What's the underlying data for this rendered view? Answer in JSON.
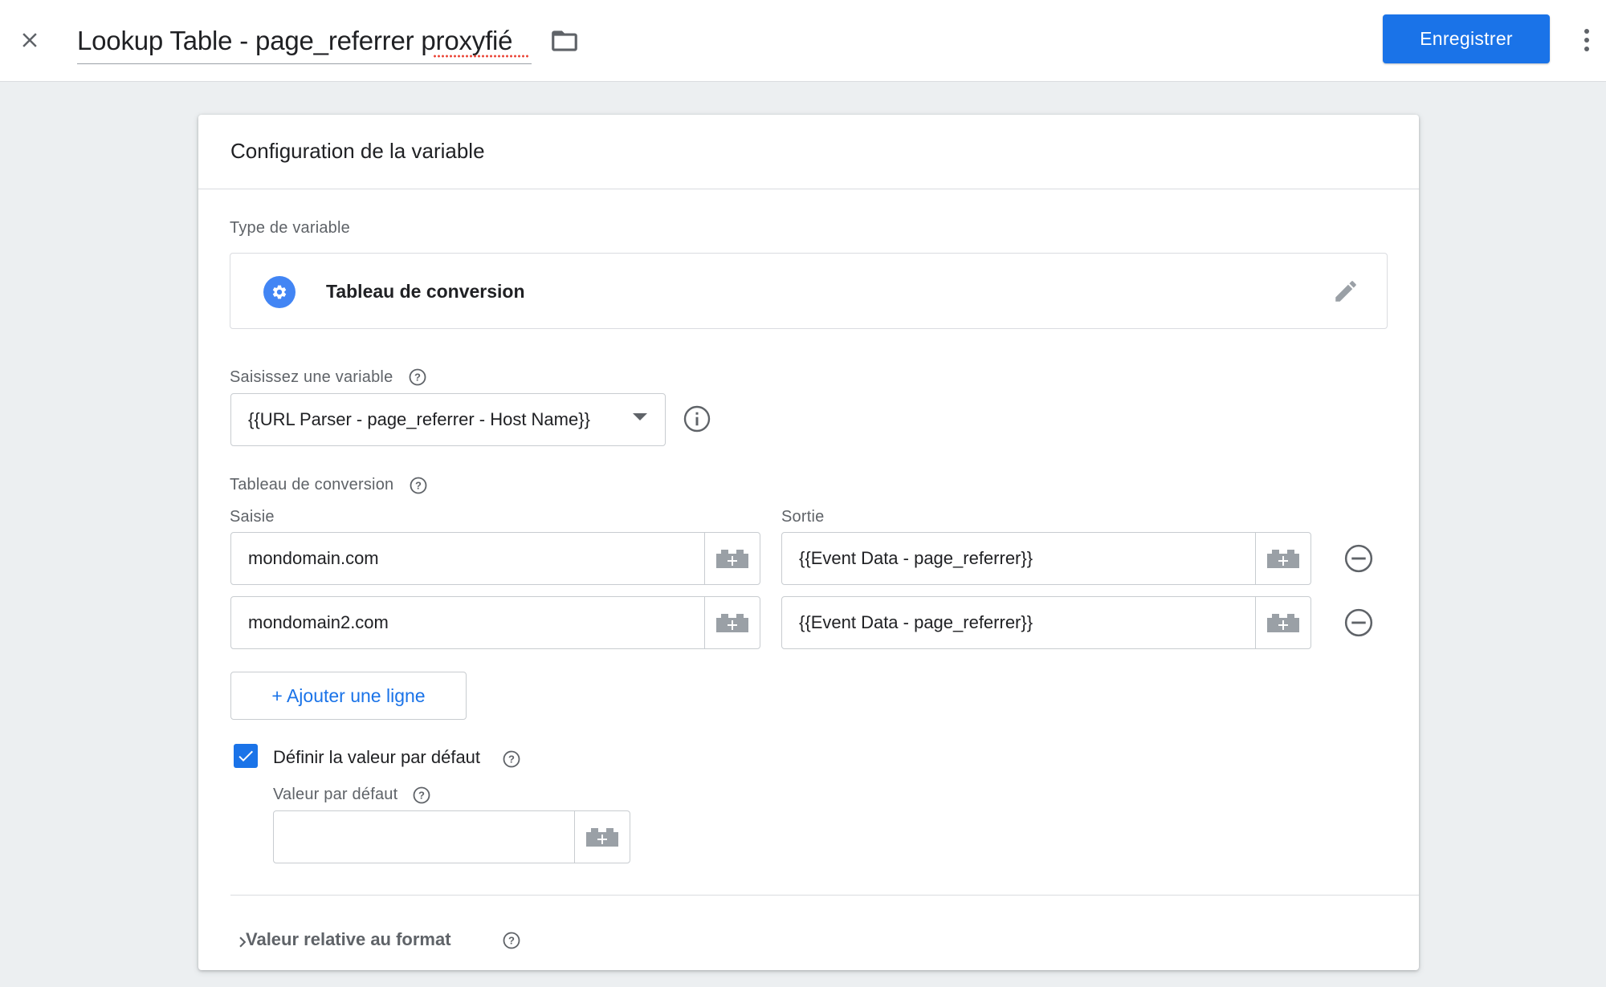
{
  "header": {
    "close_icon": "close-icon",
    "title": "Lookup Table - page_referrer proxyfié",
    "folder_icon": "folder-icon",
    "save_label": "Enregistrer",
    "more_icon": "more-vert-icon"
  },
  "card": {
    "title": "Configuration de la variable",
    "variable_type": {
      "label": "Type de variable",
      "icon": "gear-icon",
      "name": "Tableau de conversion",
      "edit_icon": "pencil-icon"
    },
    "input_variable": {
      "label": "Saisissez une variable",
      "value": "{{URL Parser - page_referrer - Host Name}}"
    },
    "lookup_table": {
      "label": "Tableau de conversion",
      "col_input": "Saisie",
      "col_output": "Sortie",
      "rows": [
        {
          "input": "mondomain.com",
          "output": "{{Event Data - page_referrer}}"
        },
        {
          "input": "mondomain2.com",
          "output": "{{Event Data - page_referrer}}"
        }
      ],
      "add_row_label": "+ Ajouter une ligne"
    },
    "default_value": {
      "checkbox_label": "Définir la valeur par défaut",
      "checked": true,
      "field_label": "Valeur par défaut",
      "value": ""
    },
    "format_section": {
      "label": "Valeur relative au format"
    }
  },
  "colors": {
    "accent": "#1a73e8",
    "page_bg": "#eceff1",
    "icon_grey": "#5f6368"
  }
}
